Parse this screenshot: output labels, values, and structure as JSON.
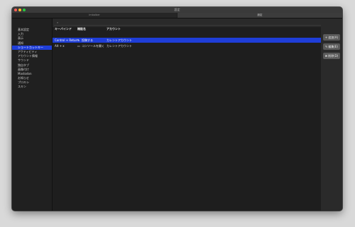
{
  "window": {
    "title": "設定"
  },
  "tabs": [
    {
      "label": "Imbalber"
    },
    {
      "label": "設定"
    }
  ],
  "sidebar": {
    "items": [
      {
        "label": "基本設定"
      },
      {
        "label": "入力"
      },
      {
        "label": "表示"
      },
      {
        "label": "通知"
      },
      {
        "label": "ショートカットキー",
        "selected": true
      },
      {
        "label": "アクティビティ"
      },
      {
        "label": "アカウント情報"
      },
      {
        "label": "サウンド"
      },
      {
        "label": "独自タブ"
      },
      {
        "label": "画像付け"
      },
      {
        "label": "Mastodon"
      },
      {
        "label": "お知らせ"
      },
      {
        "label": "プロキシ"
      },
      {
        "label": "スキン"
      }
    ]
  },
  "search": {
    "icon": "search-icon",
    "value": ""
  },
  "table": {
    "columns": [
      "キーバインド",
      "機能名",
      "アカウント"
    ],
    "rows": [
      {
        "key": "Control + Return",
        "icon": "send-icon",
        "function": "投稿する",
        "account": "カレントアカウント",
        "selected": true
      },
      {
        "key": "Alt + x",
        "icon": "console-icon",
        "function": "コンソールを開く",
        "account": "カレントアカウント",
        "selected": false
      }
    ]
  },
  "buttons": {
    "add": {
      "label": "追加(A)",
      "icon": "plus-icon"
    },
    "edit": {
      "label": "編集(E)",
      "icon": "edit-icon"
    },
    "delete": {
      "label": "削除(D)",
      "icon": "delete-icon"
    }
  },
  "colors": {
    "selection": "#1f3ed8",
    "background": "#2b2b2b"
  }
}
